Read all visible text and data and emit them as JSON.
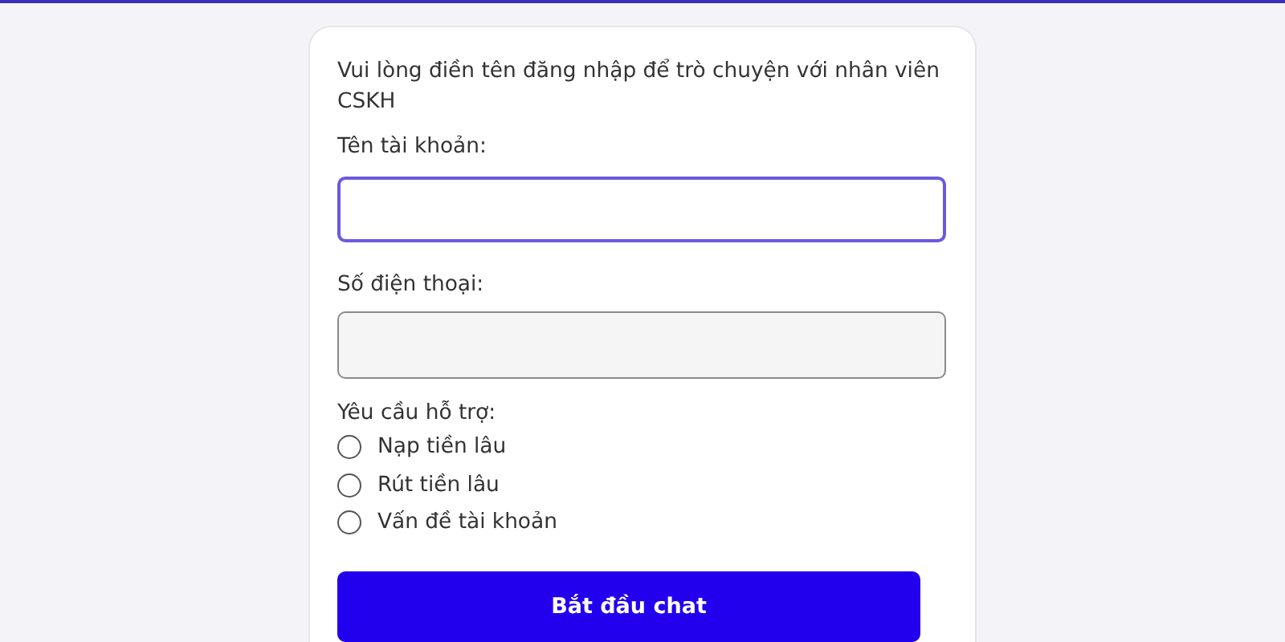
{
  "form": {
    "intro": "Vui lòng điền tên đăng nhập để trò chuyện với nhân viên CSKH",
    "fields": [
      {
        "label": "Tên tài khoản:",
        "focused": true
      },
      {
        "label": "Số điện thoại:",
        "focused": false
      }
    ],
    "support": {
      "label": "Yêu cầu hỗ trợ:",
      "options": [
        {
          "label": "Nạp tiền lâu",
          "selected": false
        },
        {
          "label": "Rút tiền lâu",
          "selected": false
        },
        {
          "label": "Vấn đề tài khoản",
          "selected": false
        }
      ]
    },
    "submit": "Bắt đầu chat"
  }
}
